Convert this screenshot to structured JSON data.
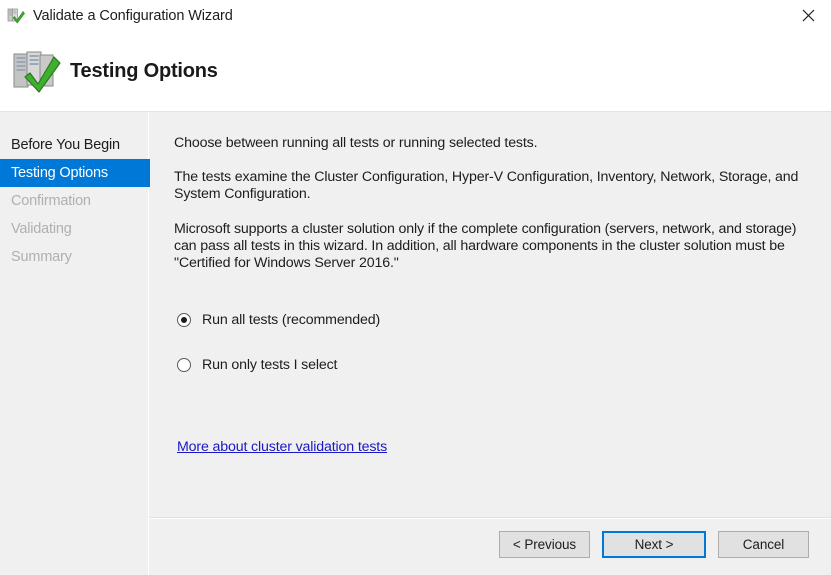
{
  "titlebar": {
    "title": "Validate a Configuration Wizard",
    "icon": "cluster-validate-icon",
    "close_label": "✕"
  },
  "header": {
    "title": "Testing Options",
    "icon": "cluster-validate-large-icon"
  },
  "sidebar": {
    "items": [
      {
        "label": "Before You Begin",
        "state": "done"
      },
      {
        "label": "Testing Options",
        "state": "active"
      },
      {
        "label": "Confirmation",
        "state": "disabled"
      },
      {
        "label": "Validating",
        "state": "disabled"
      },
      {
        "label": "Summary",
        "state": "disabled"
      }
    ]
  },
  "content": {
    "paragraph1": "Choose between running all tests or running selected tests.",
    "paragraph2": "The tests examine the Cluster Configuration, Hyper-V Configuration, Inventory, Network, Storage, and System Configuration.",
    "paragraph3": "Microsoft supports a cluster solution only if the complete configuration (servers, network, and storage) can pass all tests in this wizard. In addition, all hardware components in the cluster solution must be \"Certified for Windows Server 2016.\"",
    "options": [
      {
        "label": "Run all tests (recommended)",
        "checked": true
      },
      {
        "label": "Run only tests I select",
        "checked": false
      }
    ],
    "help_link": "More about cluster validation tests"
  },
  "footer": {
    "previous_label": "< Previous",
    "next_label": "Next >",
    "cancel_label": "Cancel"
  },
  "colors": {
    "accent": "#0078d7",
    "window_bg": "#f0f0f0",
    "link": "#1a18c6",
    "disabled_text": "#b0b0b0"
  }
}
